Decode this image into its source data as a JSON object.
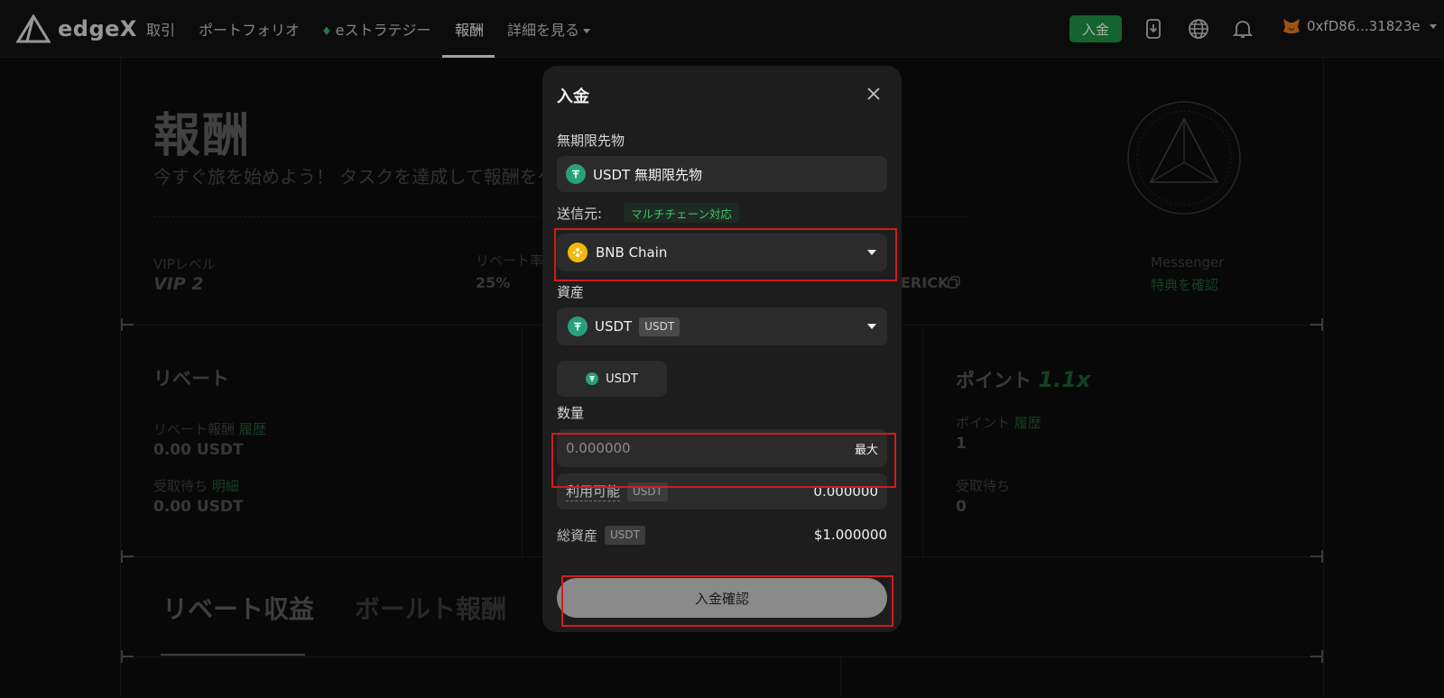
{
  "header": {
    "logo_text": "edgeX",
    "nav": [
      "取引",
      "ポートフォリオ",
      "eストラテジー",
      "報酬",
      "詳細を見る"
    ],
    "deposit_label": "入金",
    "account": "0xfD86...31823e"
  },
  "page": {
    "title": "報酬",
    "subtitle": "今すぐ旅を始めよう！ タスクを達成して報酬をゲ",
    "stats": {
      "vip_label": "VIPレベル",
      "vip_value": "VIP 2",
      "rebate_rate_label": "リベート率",
      "rebate_rate_value": "25%",
      "code_value": "ERICK",
      "messenger_label": "Messenger",
      "messenger_link": "特典を確認"
    },
    "rebate": {
      "title": "リベート",
      "reward_label": "リベート報酬",
      "history_link": "履歴",
      "reward_value": "0.00 USDT",
      "pending_label": "受取待ち",
      "detail_link": "明細",
      "pending_value": "0.00 USDT"
    },
    "points": {
      "title": "ポイント",
      "multiplier": "1.1x",
      "points_label": "ポイント",
      "history_link": "履歴",
      "points_value": "1",
      "pending_label": "受取待ち",
      "pending_value": "0"
    },
    "tabs": [
      "リベート収益",
      "ボールト報酬"
    ]
  },
  "modal": {
    "title": "入金",
    "product_label": "無期限先物",
    "product_value": "USDT 無期限先物",
    "source_label": "送信元:",
    "multichain_badge": "マルチチェーン対応",
    "chain_value": "BNB Chain",
    "asset_label": "資産",
    "asset_value": "USDT",
    "asset_tag": "USDT",
    "asset_chip": "USDT",
    "amount_label": "数量",
    "amount_placeholder": "0.000000",
    "max_label": "最大",
    "available_label": "利用可能",
    "available_tag": "USDT",
    "available_value": "0.000000",
    "total_label": "総資産",
    "total_tag": "USDT",
    "total_value": "$1.000000",
    "confirm_label": "入金確認"
  },
  "colors": {
    "accent_green": "#1f8f43",
    "highlight_red": "#d31b1b",
    "modal_bg": "#1d1d1d"
  }
}
